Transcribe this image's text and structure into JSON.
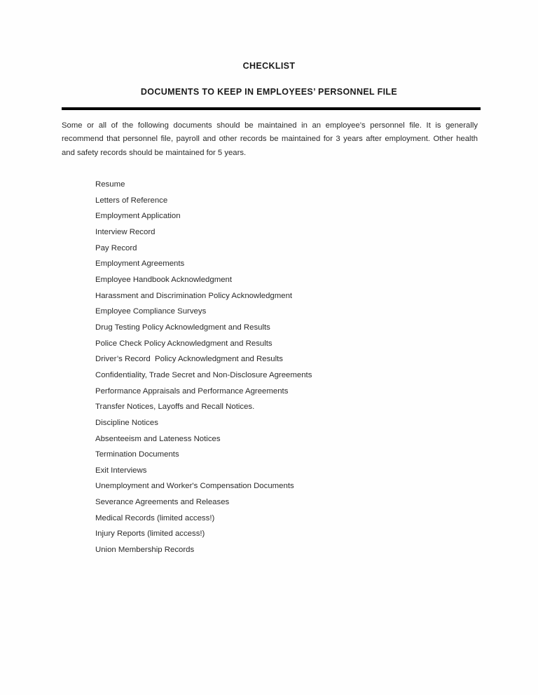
{
  "document": {
    "heading_primary": "CHECKLIST",
    "heading_secondary": "DOCUMENTS TO KEEP IN EMPLOYEES’ PERSONNEL FILE",
    "intro_paragraph": "Some or all of the following documents should be maintained in an employee’s personnel file. It is generally recommend that personnel file, payroll and other records be maintained for 3 years after employment. Other health and safety records should be maintained for 5 years.",
    "checklist_items": [
      "Resume",
      "Letters of Reference",
      "Employment Application",
      "Interview Record",
      "Pay Record",
      "Employment Agreements",
      "Employee Handbook Acknowledgment",
      "Harassment and Discrimination Policy Acknowledgment",
      "Employee Compliance Surveys",
      "Drug Testing Policy Acknowledgment and Results",
      "Police Check Policy Acknowledgment and Results",
      "Driver’s Record  Policy Acknowledgment and Results",
      "Confidentiality, Trade Secret and Non-Disclosure Agreements",
      "Performance Appraisals and Performance Agreements",
      "Transfer Notices, Layoffs and Recall Notices.",
      "Discipline Notices",
      "Absenteeism and Lateness Notices",
      "Termination Documents",
      "Exit Interviews",
      "Unemployment and Worker's Compensation Documents",
      "Severance Agreements and Releases",
      "Medical Records (limited access!)",
      "Injury Reports (limited access!)",
      "Union Membership Records"
    ]
  },
  "colors": {
    "page_background": "#fefefe",
    "body_text": "#2b2b2b",
    "heading_text": "#1b1b1b",
    "divider": "#000000"
  }
}
